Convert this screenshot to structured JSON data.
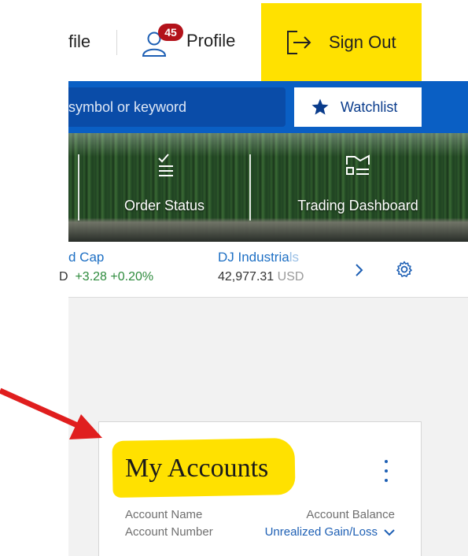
{
  "header": {
    "truncated_link": "file",
    "profile_label": "Profile",
    "notification_count": "45",
    "signout_label": "Sign Out"
  },
  "search": {
    "placeholder": "symbol or keyword",
    "watchlist_label": "Watchlist"
  },
  "banner": {
    "items": [
      {
        "label": "Order Status",
        "icon": "checklist-icon"
      },
      {
        "label": "Trading Dashboard",
        "icon": "dashboard-icon"
      }
    ]
  },
  "ticker": {
    "items": [
      {
        "name": "d Cap",
        "value": "D",
        "change": "+3.28",
        "change_pct": "+0.20%"
      },
      {
        "name_main": "DJ Industria",
        "name_faded": "ls",
        "value": "42,977.31",
        "unit": "USD"
      }
    ]
  },
  "accounts": {
    "title": "My Accounts",
    "col_left_1": "Account Name",
    "col_left_2": "Account Number",
    "col_right_1": "Account Balance",
    "sort_label": "Unrealized Gain/Loss"
  },
  "colors": {
    "brand_blue": "#0a5fc4",
    "highlight_yellow": "#ffe100",
    "badge_red": "#b3121a",
    "positive_green": "#2e8b3d",
    "annotation_red": "#e01e1e"
  }
}
